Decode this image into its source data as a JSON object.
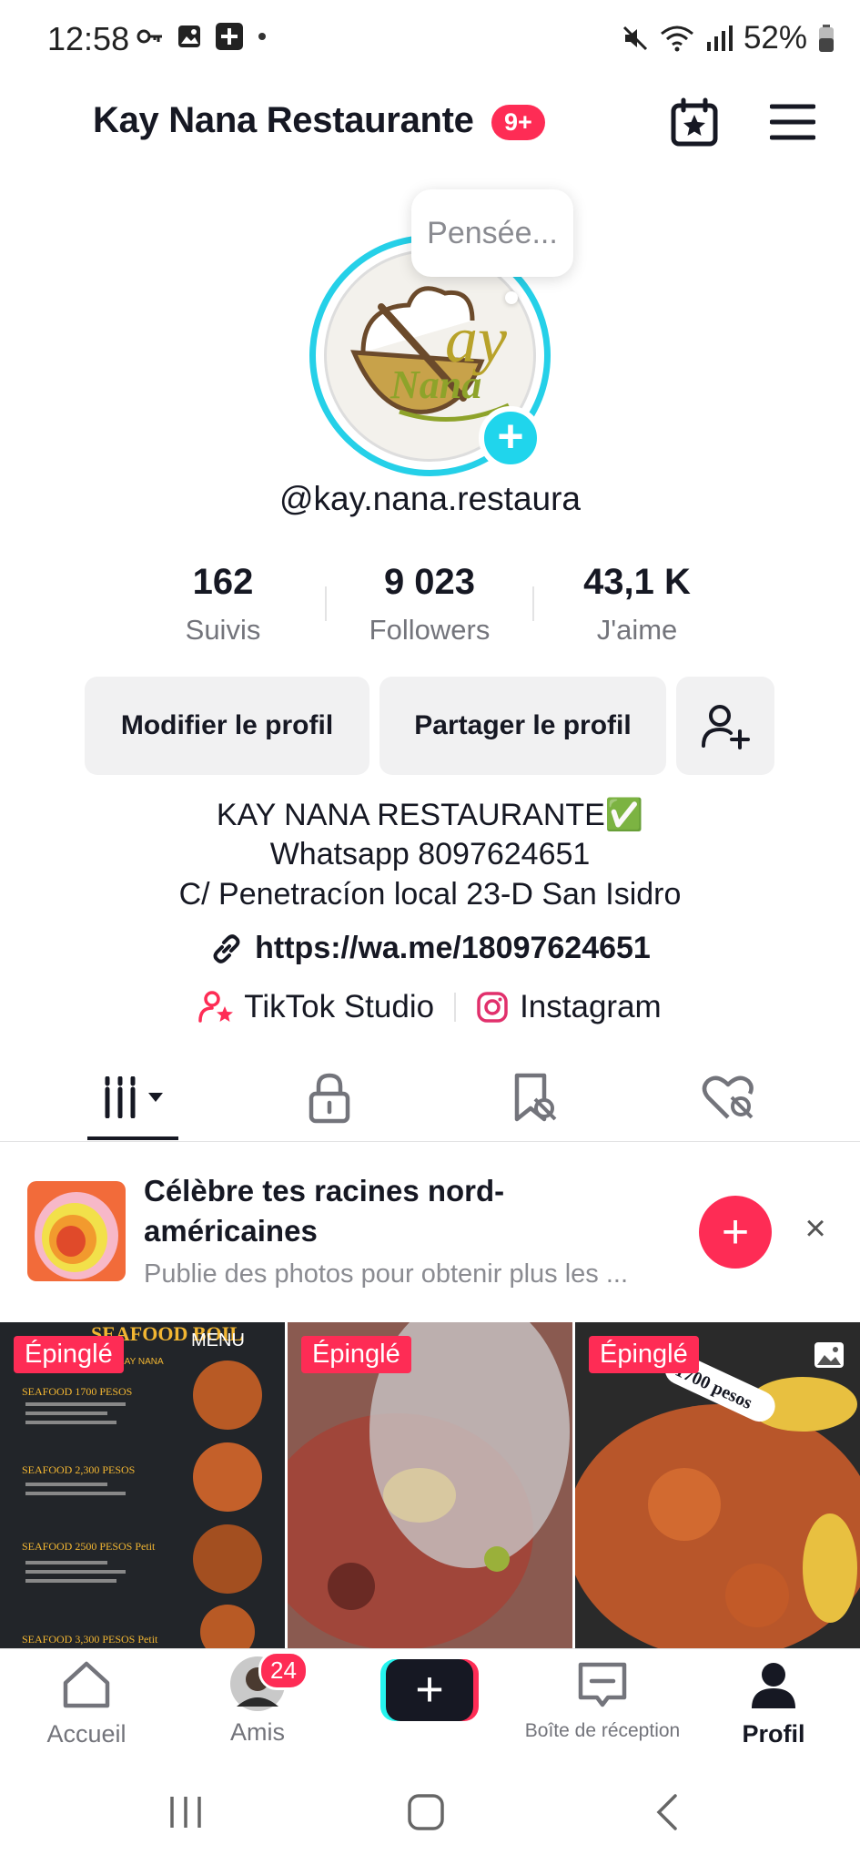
{
  "status_bar": {
    "time": "12:58",
    "battery": "52%"
  },
  "header": {
    "title": "Kay Nana Restaurante",
    "badge": "9+"
  },
  "avatar": {
    "thought_bubble": "Pensée...",
    "logo_text": "Kay Nana"
  },
  "profile": {
    "username": "@kay.nana.restaura",
    "stats": [
      {
        "value": "162",
        "label": "Suivis"
      },
      {
        "value": "9 023",
        "label": "Followers"
      },
      {
        "value": "43,1 K",
        "label": "J'aime"
      }
    ],
    "edit_button": "Modifier le profil",
    "share_button": "Partager le profil",
    "bio_lines": [
      "KAY NANA RESTAURANTE✅",
      "Whatsapp 8097624651",
      "C/ Penetracíon local 23-D San Isidro"
    ],
    "link": "https://wa.me/18097624651",
    "studio_link": "TikTok Studio",
    "instagram_link": "Instagram"
  },
  "promo": {
    "title": "Célèbre tes racines nord-américaines",
    "subtitle": "Publie des photos pour obtenir plus les ..."
  },
  "grid": {
    "pinned_label": "Épinglé",
    "thumb1": {
      "heading": "SEAFOOD BOIL",
      "menu": "MENU",
      "brand": "KAY NANA",
      "items": [
        "SEAFOOD 1700 PESOS",
        "SEAFOOD 2,300 PESOS",
        "SEAFOOD 2500 PESOS Petit",
        "SEAFOOD 3,300 PESOS Petit"
      ]
    },
    "thumb3": {
      "price_tag": "1700 pesos"
    }
  },
  "bottom_nav": {
    "home": "Accueil",
    "friends": "Amis",
    "friends_badge": "24",
    "inbox": "Boîte de réception",
    "profile": "Profil"
  },
  "colors": {
    "accent": "#fe2c55",
    "cyan": "#20d5ec",
    "text": "#161823",
    "secondary": "#73747b"
  }
}
